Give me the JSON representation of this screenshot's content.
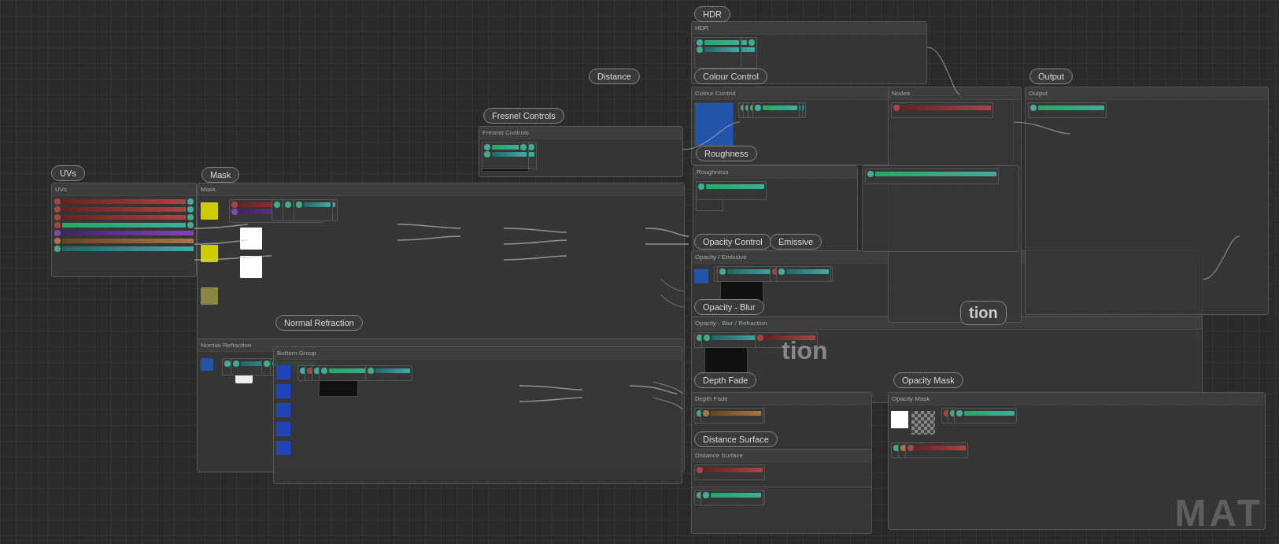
{
  "labels": {
    "uvs": "UVs",
    "mask": "Mask",
    "normalRefraction": "Normal Refraction",
    "distance": "Distance",
    "fresnelControls": "Fresnel Controls",
    "hdr": "HDR",
    "colourControl": "Colour Control",
    "roughness": "Roughness",
    "opacityControl": "Opacity Control",
    "emissive": "Emissive",
    "opacityBlur": "Opacity - Blur",
    "refraction": "tion",
    "depthFade": "Depth Fade",
    "opacityMask": "Opacity Mask",
    "distanceSurface": "Distance Surface",
    "output": "Output",
    "mat": "MAT"
  },
  "colors": {
    "background": "#2a2a2a",
    "nodeGroup": "#3c3c3c",
    "nodeBorder": "#555555",
    "labelBg": "#3a3a3a",
    "labelBorder": "#888888",
    "textColor": "#e0e0e0"
  }
}
